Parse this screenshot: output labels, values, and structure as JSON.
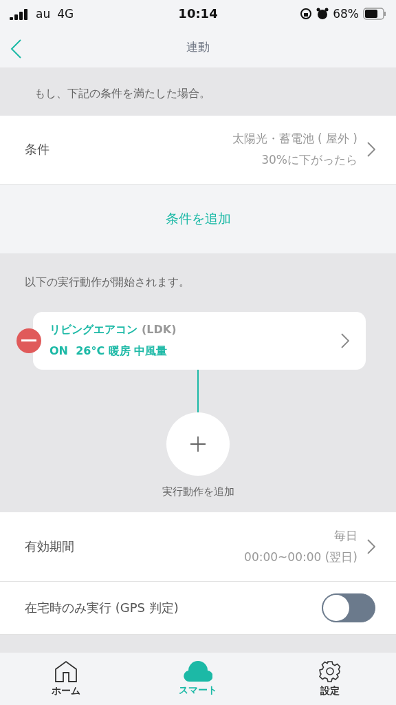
{
  "status_bar": {
    "carrier": "au",
    "network": "4G",
    "time": "10:14",
    "battery": "68%"
  },
  "nav": {
    "title": "連動"
  },
  "condition_header": "もし、下記の条件を満たした場合。",
  "condition": {
    "label": "条件",
    "value_lines": [
      "太陽光・蓄電池 ( 屋外 )",
      "30%に下がったら"
    ]
  },
  "add_condition": "条件を追加",
  "action_header": "以下の実行動作が開始されます。",
  "actions": [
    {
      "name": "リビングエアコン",
      "suffix": "(LDK)",
      "detail": "ON  26°C 暖房 中風量"
    }
  ],
  "add_action": "実行動作を追加",
  "validity": {
    "label": "有効期間",
    "value_lines": [
      "毎日",
      "00:00~00:00 (翌日)"
    ]
  },
  "gps": {
    "label": "在宅時のみ実行 (GPS 判定)",
    "on": false
  },
  "tabs": [
    {
      "label": "ホーム",
      "kind": "home",
      "selected": false
    },
    {
      "label": "スマート",
      "kind": "cloud",
      "selected": true
    },
    {
      "label": "設定",
      "kind": "gear",
      "selected": false
    }
  ]
}
